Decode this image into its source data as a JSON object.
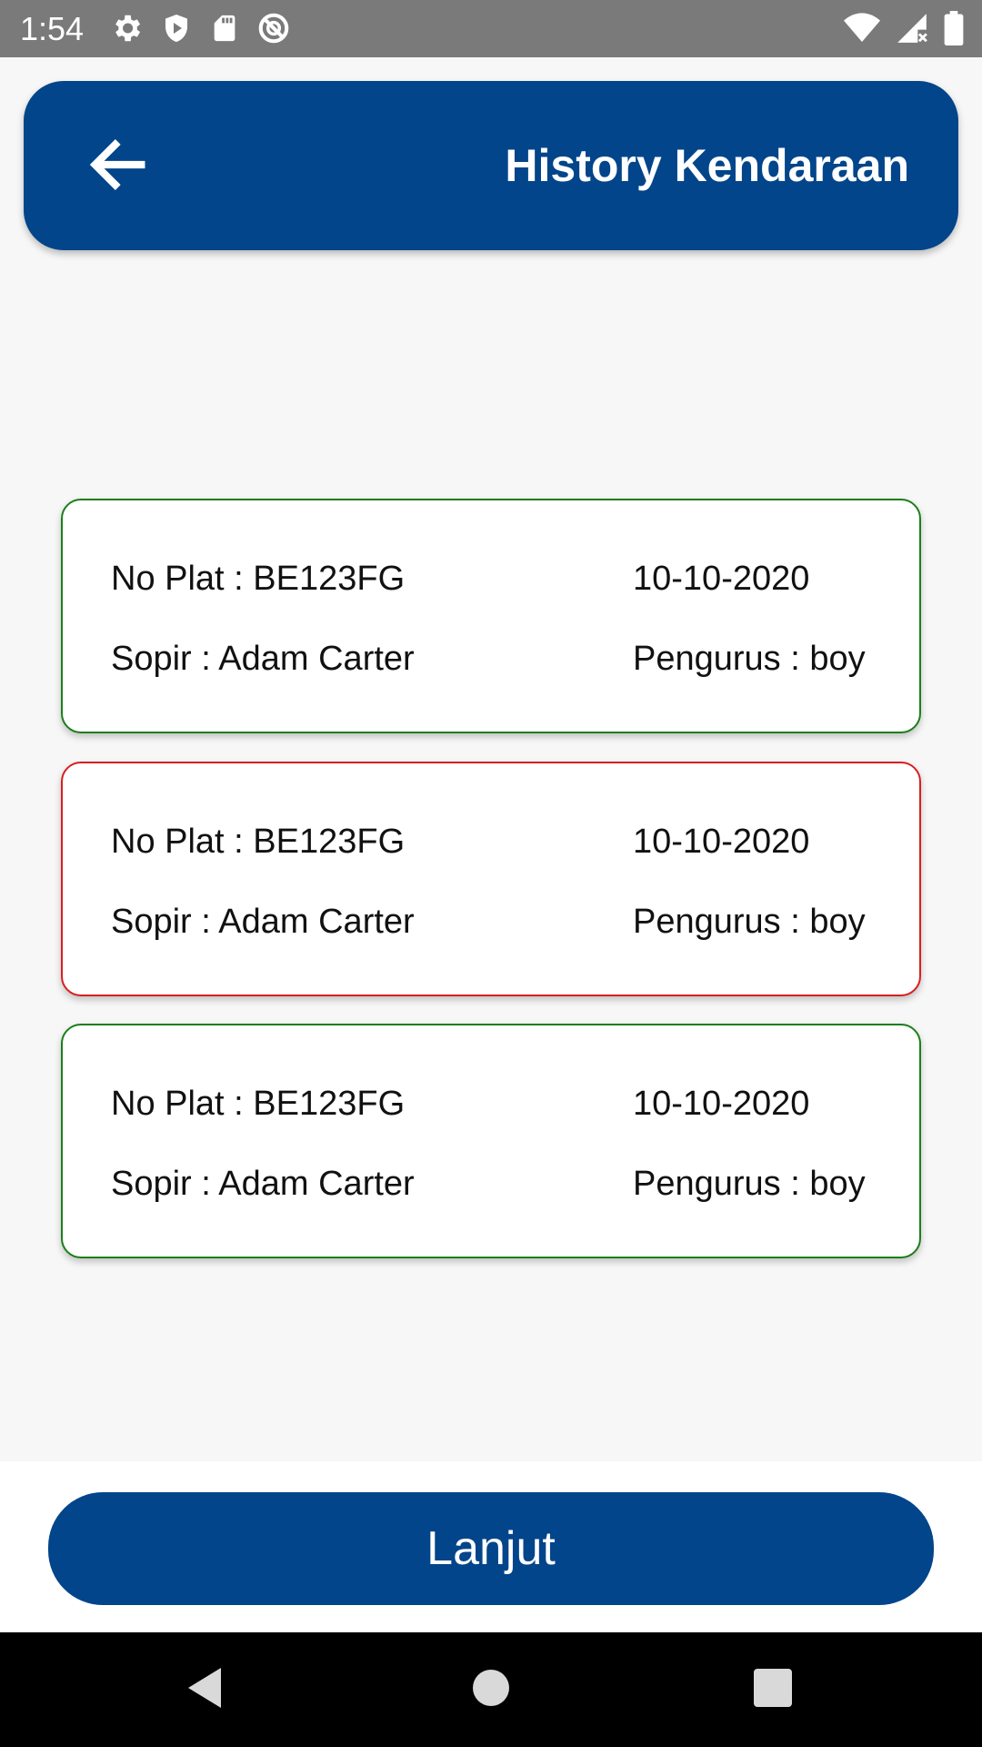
{
  "status_bar": {
    "time": "1:54",
    "icons_left": [
      "gear-icon",
      "shield-icon",
      "sd-card-icon",
      "do-not-disturb-icon"
    ],
    "icons_right": [
      "wifi-icon",
      "signal-icon",
      "battery-icon"
    ]
  },
  "header": {
    "title": "History Kendaraan",
    "back_icon": "arrow-left-icon"
  },
  "records": [
    {
      "plate": "No Plat : BE123FG",
      "date": "10-10-2020",
      "driver": "Sopir : Adam Carter",
      "manager": "Pengurus : boy",
      "border_color": "#1a7f1a"
    },
    {
      "plate": "No Plat : BE123FG",
      "date": "10-10-2020",
      "driver": "Sopir : Adam Carter",
      "manager": "Pengurus : boy",
      "border_color": "#d81f1f"
    },
    {
      "plate": "No Plat : BE123FG",
      "date": "10-10-2020",
      "driver": "Sopir : Adam Carter",
      "manager": "Pengurus : boy",
      "border_color": "#1a7f1a"
    }
  ],
  "footer": {
    "continue_label": "Lanjut"
  },
  "colors": {
    "primary": "#02458a",
    "background": "#f7f7f7"
  },
  "nav_bar": {
    "icons": [
      "back-triangle-icon",
      "home-circle-icon",
      "recents-square-icon"
    ]
  }
}
